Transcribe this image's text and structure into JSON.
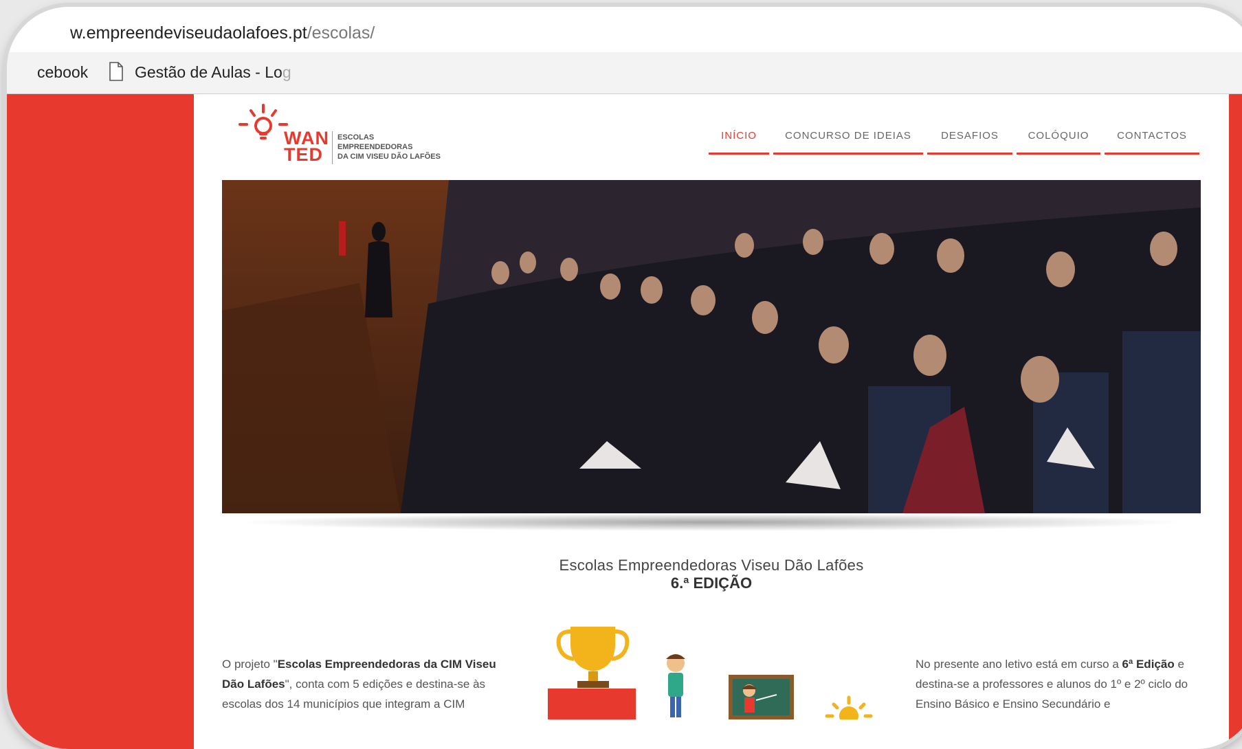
{
  "browser": {
    "url_host": "w.empreendeviseudaolafoes.pt",
    "url_path": "/escolas/",
    "bookmarks": [
      {
        "label": "cebook"
      },
      {
        "label_main": "Gestão de Aulas - Lo",
        "label_fade": "g"
      }
    ]
  },
  "header": {
    "logo_word_1": "WAN",
    "logo_word_2": "TED",
    "logo_tagline_1": "Escolas",
    "logo_tagline_2": "Empreendedoras",
    "logo_tagline_3": "da CIM Viseu Dão Lafões",
    "nav": [
      "INÍCIO",
      "CONCURSO DE IDEIAS",
      "DESAFIOS",
      "COLÓQUIO",
      "CONTACTOS"
    ],
    "active_nav": "INÍCIO"
  },
  "content": {
    "title": "Escolas Empreendedoras Viseu Dão Lafões",
    "subtitle": "6.ª EDIÇÃO",
    "left_text_pre": "O projeto \"",
    "left_text_bold": "Escolas Empreendedoras da CIM Viseu Dão Lafões",
    "left_text_post": "\", conta com 5 edições e destina-se às escolas dos 14 municípios que integram a CIM",
    "right_text_pre": "No presente ano letivo está em curso a ",
    "right_text_bold": "6ª Edição",
    "right_text_post": " e destina-se a professores e alunos do 1º e 2º ciclo do Ensino Básico e Ensino Secundário e"
  },
  "colors": {
    "accent": "#e8392f"
  },
  "icons": [
    "lightbulb-icon",
    "document-icon",
    "trophy-icon",
    "student-icon",
    "chalkboard-icon",
    "sun-icon"
  ]
}
